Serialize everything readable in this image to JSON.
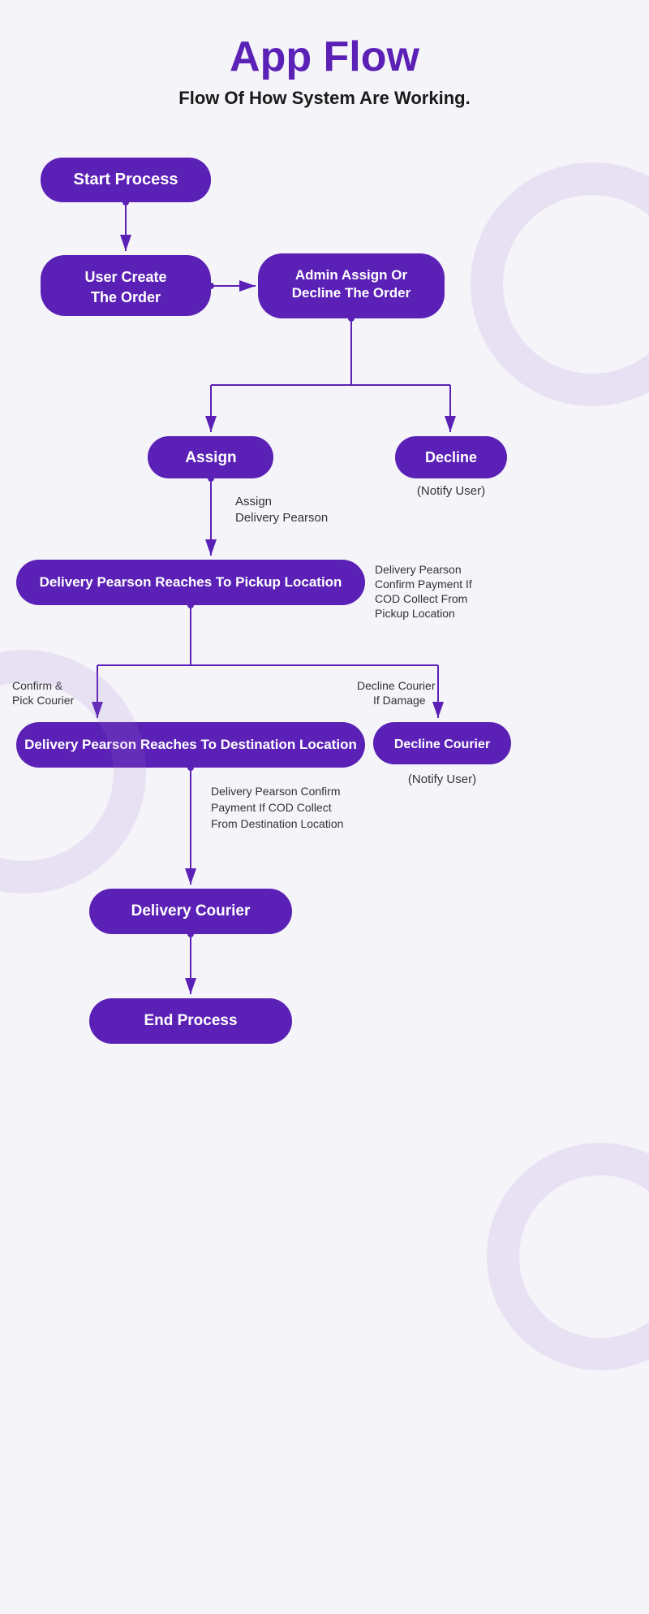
{
  "header": {
    "title": "App Flow",
    "subtitle": "Flow Of How System Are Working."
  },
  "nodes": {
    "start": "Start Process",
    "user_create": "User Create\nThe Order",
    "admin_assign": "Admin Assign Or\nDecline The Order",
    "assign": "Assign",
    "decline": "Decline",
    "decline_notify": "(Notify User)",
    "assign_label": "Assign\nDelivery Pearson",
    "pickup": "Delivery Pearson Reaches To Pickup Location",
    "pickup_annotation": "Delivery Pearson\nConfirm Payment If\nCOD Collect From\nPickup Location",
    "confirm_label": "Confirm &\nPick Courier",
    "decline_courier_label": "Decline Courier\nIf Damage",
    "destination": "Delivery Pearson Reaches To Destination Location",
    "decline_courier": "Decline Courier",
    "decline_courier_notify": "(Notify User)",
    "destination_annotation": "Delivery Pearson Confirm\nPayment If COD Collect\nFrom Destination Location",
    "delivery_courier": "Delivery Courier",
    "end": "End Process"
  },
  "colors": {
    "primary": "#5b21b6",
    "background": "#f5f4f9",
    "deco": "rgba(160,120,210,0.15)",
    "text_dark": "#1a1a1a",
    "text_annotation": "#333333",
    "arrow": "#5b21b6"
  }
}
